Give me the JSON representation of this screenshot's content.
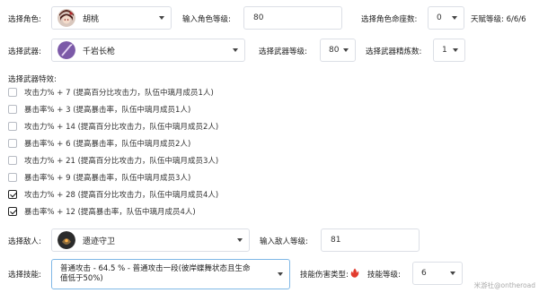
{
  "character": {
    "label": "选择角色:",
    "selected": "胡桃",
    "level_label": "输入角色等级:",
    "level_value": "80",
    "constellation_label": "选择角色命座数:",
    "constellation_value": "0",
    "talent_label": "天赋等级: 6/6/6"
  },
  "weapon": {
    "label": "选择武器:",
    "selected": "千岩长枪",
    "level_label": "选择武器等级:",
    "level_value": "80",
    "refine_label": "选择武器精炼数:",
    "refine_value": "1"
  },
  "effects": {
    "label": "选择武器特效:",
    "items": [
      {
        "text": "攻击力% + 7 (提高百分比攻击力，队伍中璃月成员1人)",
        "checked": false
      },
      {
        "text": "暴击率% + 3 (提高暴击率，队伍中璃月成员1人)",
        "checked": false
      },
      {
        "text": "攻击力% + 14 (提高百分比攻击力，队伍中璃月成员2人)",
        "checked": false
      },
      {
        "text": "暴击率% + 6 (提高暴击率，队伍中璃月成员2人)",
        "checked": false
      },
      {
        "text": "攻击力% + 21 (提高百分比攻击力，队伍中璃月成员3人)",
        "checked": false
      },
      {
        "text": "暴击率% + 9 (提高暴击率，队伍中璃月成员3人)",
        "checked": false
      },
      {
        "text": "攻击力% + 28 (提高百分比攻击力，队伍中璃月成员4人)",
        "checked": true
      },
      {
        "text": "暴击率% + 12 (提高暴击率，队伍中璃月成员4人)",
        "checked": true
      }
    ]
  },
  "enemy": {
    "label": "选择敌人:",
    "selected": "遗迹守卫",
    "level_label": "输入敌人等级:",
    "level_value": "81"
  },
  "skill": {
    "label": "选择技能:",
    "selected_line1": "普通攻击 - 64.5 % - 普通攻击一段(彼岸蝶舞状态且生命",
    "selected_line2": "值低于50%)",
    "damage_type_label": "技能伤害类型:",
    "damage_type_icon": "fire",
    "level_label": "技能等级:",
    "level_value": "6"
  },
  "watermark": "米游社@ontheroad",
  "colors": {
    "pyro": "#e23b2e",
    "skill_border": "#7fb8e6"
  }
}
